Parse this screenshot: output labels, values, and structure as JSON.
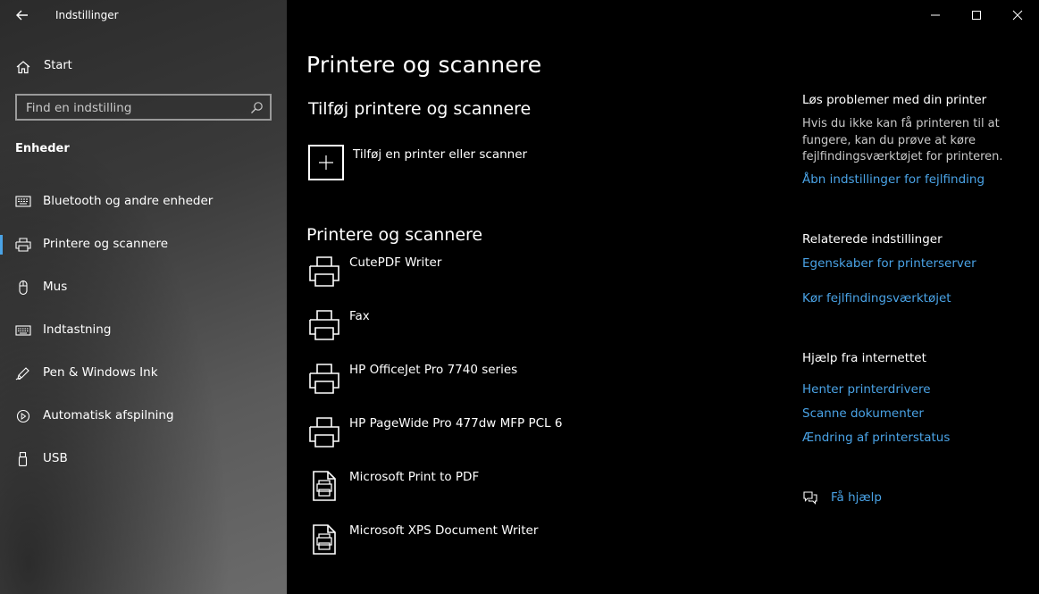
{
  "window": {
    "title": "Indstillinger"
  },
  "sidebar": {
    "home_label": "Start",
    "search_placeholder": "Find en indstilling",
    "section_heading": "Enheder",
    "items": [
      {
        "label": "Bluetooth og andre enheder",
        "icon": "bluetooth-devices-icon"
      },
      {
        "label": "Printere og scannere",
        "icon": "printer-icon",
        "active": true
      },
      {
        "label": "Mus",
        "icon": "mouse-icon"
      },
      {
        "label": "Indtastning",
        "icon": "keyboard-icon"
      },
      {
        "label": "Pen & Windows Ink",
        "icon": "pen-icon"
      },
      {
        "label": "Automatisk afspilning",
        "icon": "autoplay-icon"
      },
      {
        "label": "USB",
        "icon": "usb-icon"
      }
    ]
  },
  "main": {
    "title": "Printere og scannere",
    "add_section_heading": "Tilføj printere og scannere",
    "add_button_label": "Tilføj en printer eller scanner",
    "list_heading": "Printere og scannere",
    "printers": [
      {
        "name": "CutePDF Writer",
        "icon": "printer-icon"
      },
      {
        "name": "Fax",
        "icon": "printer-icon"
      },
      {
        "name": "HP OfficeJet Pro 7740 series",
        "icon": "printer-icon"
      },
      {
        "name": "HP PageWide Pro 477dw MFP PCL 6",
        "icon": "printer-icon"
      },
      {
        "name": "Microsoft Print to PDF",
        "icon": "document-printer-icon"
      },
      {
        "name": "Microsoft XPS Document Writer",
        "icon": "document-printer-icon"
      }
    ]
  },
  "right": {
    "troubleshoot_heading": "Løs problemer med din printer",
    "troubleshoot_text": "Hvis du ikke kan få printeren til at fungere, kan du prøve at køre fejlfindingsværktøjet for printeren.",
    "troubleshoot_link": "Åbn indstillinger for fejlfinding",
    "related_heading": "Relaterede indstillinger",
    "related_links": [
      "Egenskaber for printerserver",
      "Kør fejlfindingsværktøjet"
    ],
    "help_heading": "Hjælp fra internettet",
    "help_links": [
      "Henter printerdrivere",
      "Scanne dokumenter",
      "Ændring af printerstatus"
    ],
    "get_help_label": "Få hjælp"
  },
  "colors": {
    "accent": "#4aa3e6",
    "background": "#000000"
  }
}
